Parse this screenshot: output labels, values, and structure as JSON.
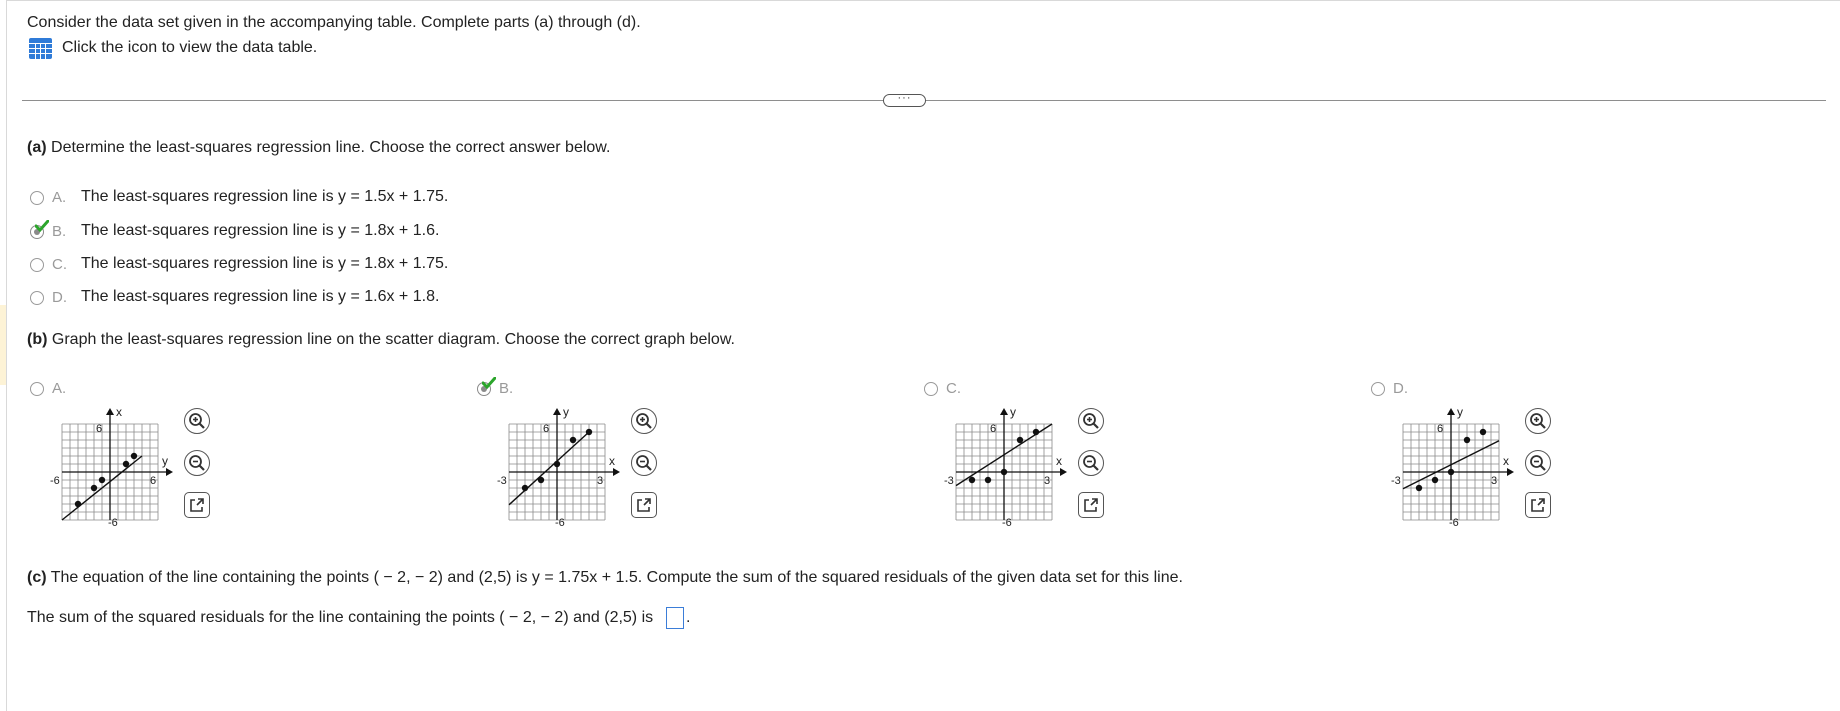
{
  "intro": {
    "line1": "Consider the data set given in the accompanying table. Complete parts (a) through (d).",
    "line2": "Click the icon to view the data table."
  },
  "more_button": "···",
  "part_a": {
    "label": "(a)",
    "prompt": "Determine the least-squares regression line. Choose the correct answer below.",
    "options": [
      {
        "letter": "A.",
        "text": "The least-squares regression line is y = 1.5x + 1.75.",
        "selected": false
      },
      {
        "letter": "B.",
        "text": "The least-squares regression line is y = 1.8x + 1.6.",
        "selected": true
      },
      {
        "letter": "C.",
        "text": "The least-squares regression line is y = 1.8x + 1.75.",
        "selected": false
      },
      {
        "letter": "D.",
        "text": "The least-squares regression line is y = 1.6x + 1.8.",
        "selected": false
      }
    ]
  },
  "part_b": {
    "label": "(b)",
    "prompt": "Graph the least-squares regression line on the scatter diagram. Choose the correct graph below.",
    "options": [
      {
        "letter": "A.",
        "selected": false,
        "graph": {
          "vlabel": "x",
          "hlabel": "y",
          "ticks": [
            "6",
            "-6",
            "6",
            "-6"
          ],
          "xlim": [
            -6,
            6
          ],
          "ylim": [
            -6,
            6
          ],
          "points": [
            [
              -4,
              -4
            ],
            [
              -2,
              -2
            ],
            [
              -1,
              -1
            ],
            [
              2,
              1
            ],
            [
              3,
              2
            ]
          ],
          "line": [
            [
              -6,
              -6
            ],
            [
              4,
              2
            ]
          ]
        }
      },
      {
        "letter": "B.",
        "selected": true,
        "graph": {
          "vlabel": "y",
          "hlabel": "x",
          "ticks": [
            "6",
            "-3",
            "3",
            "-6"
          ],
          "xlim": [
            -3,
            3
          ],
          "ylim": [
            -6,
            6
          ],
          "points": [
            [
              -2,
              -2
            ],
            [
              -1,
              -1
            ],
            [
              0,
              1
            ],
            [
              1,
              4
            ],
            [
              2,
              5
            ]
          ],
          "line": [
            [
              -3,
              -4.1
            ],
            [
              2,
              5
            ]
          ]
        }
      },
      {
        "letter": "C.",
        "selected": false,
        "graph": {
          "vlabel": "y",
          "hlabel": "x",
          "ticks": [
            "6",
            "-3",
            "3",
            "-6"
          ],
          "xlim": [
            -3,
            3
          ],
          "ylim": [
            -6,
            6
          ],
          "points": [
            [
              -2,
              -1
            ],
            [
              -1,
              -1
            ],
            [
              0,
              0
            ],
            [
              1,
              4
            ],
            [
              2,
              5
            ]
          ],
          "line": [
            [
              -3,
              -1.7
            ],
            [
              3,
              6
            ]
          ]
        }
      },
      {
        "letter": "D.",
        "selected": false,
        "graph": {
          "vlabel": "y",
          "hlabel": "x",
          "ticks": [
            "6",
            "-3",
            "3",
            "-6"
          ],
          "xlim": [
            -3,
            3
          ],
          "ylim": [
            -6,
            6
          ],
          "points": [
            [
              -2,
              -2
            ],
            [
              -1,
              -1
            ],
            [
              0,
              0
            ],
            [
              1,
              4
            ],
            [
              2,
              5
            ]
          ],
          "line": [
            [
              -3,
              -2.1
            ],
            [
              3,
              3.9
            ]
          ]
        }
      }
    ]
  },
  "part_c": {
    "label": "(c)",
    "prompt": "The equation of the line containing the points ( − 2, − 2) and (2,5) is y = 1.75x + 1.5. Compute the sum of the squared residuals of the given data set for this line.",
    "answer_prefix": "The sum of the squared residuals for the line containing the points ( − 2, − 2) and (2,5) is",
    "answer_suffix": ".",
    "answer_value": ""
  },
  "colors": {
    "check": "#2ba52b",
    "icon_blue": "#2f7bd8",
    "input_border": "#3b7dd8"
  }
}
